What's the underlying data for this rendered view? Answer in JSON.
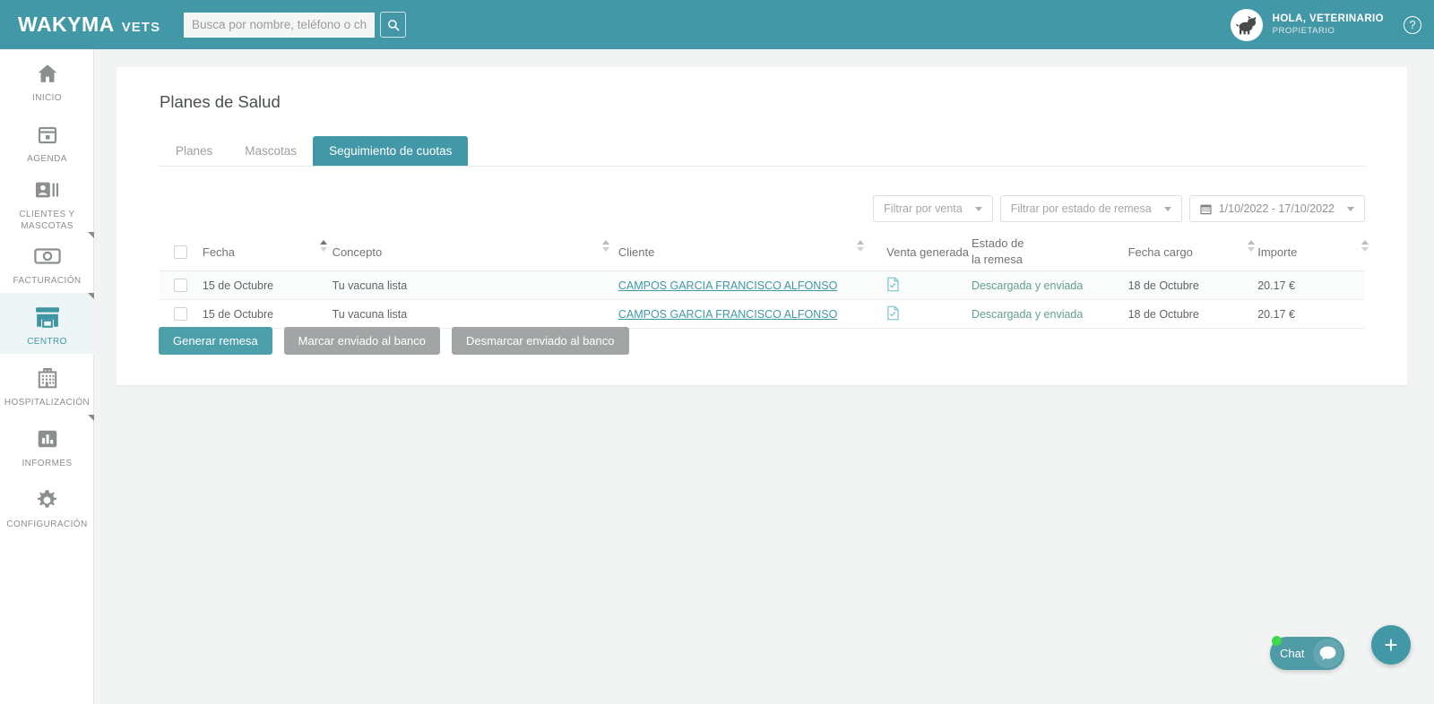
{
  "brand": {
    "main": "WAKYMA",
    "sub": "VETS"
  },
  "search": {
    "placeholder": "Busca por nombre, teléfono o chip",
    "value": "",
    "icon": "search-icon"
  },
  "user": {
    "greeting": "HOLA, VETERINARIO",
    "role": "PROPIETARIO",
    "help": "?"
  },
  "colors": {
    "brand_teal": "#4398a7",
    "active_nav_bg": "#eef5f6",
    "page_bg": "#f2f4f4",
    "status_green": "#62a08a",
    "secondary_btn": "#a2a5a6",
    "chat_green_dot": "#3ddb4a"
  },
  "sidebar": {
    "items": [
      {
        "label": "INICIO",
        "icon": "home-icon",
        "active": false
      },
      {
        "label": "AGENDA",
        "icon": "calendar-icon",
        "active": false
      },
      {
        "label": "CLIENTES Y MASCOTAS",
        "icon": "contacts-icon",
        "active": false
      },
      {
        "label": "FACTURACIÓN",
        "icon": "banknote-icon",
        "active": false
      },
      {
        "label": "CENTRO",
        "icon": "store-icon",
        "active": true
      },
      {
        "label": "HOSPITALIZACIÓN",
        "icon": "hospital-icon",
        "active": false
      },
      {
        "label": "INFORMES",
        "icon": "bar-chart-icon",
        "active": false
      },
      {
        "label": "CONFIGURACIÓN",
        "icon": "gear-icon",
        "active": false
      }
    ]
  },
  "main": {
    "title": "Planes de Salud",
    "tabs": [
      {
        "label": "Planes",
        "active": false
      },
      {
        "label": "Mascotas",
        "active": false
      },
      {
        "label": "Seguimiento de cuotas",
        "active": true
      }
    ],
    "filters": [
      {
        "label": "Filtrar por venta",
        "type": "dropdown"
      },
      {
        "label": "Filtrar por estado de remesa",
        "type": "dropdown"
      }
    ],
    "date_range": {
      "label": "1/10/2022 - 17/10/2022",
      "icon": "calendar-icon"
    },
    "table": {
      "columns": [
        {
          "key": "select",
          "label": ""
        },
        {
          "key": "fecha",
          "label": "Fecha",
          "sortable": true,
          "sorted": "asc"
        },
        {
          "key": "concepto",
          "label": "Concepto",
          "sortable": true
        },
        {
          "key": "cliente",
          "label": "Cliente",
          "sortable": true
        },
        {
          "key": "venta",
          "label": "Venta generada",
          "sortable": true
        },
        {
          "key": "estado",
          "label": "Estado de la remesa",
          "label_line1": "Estado de",
          "label_line2": "la remesa"
        },
        {
          "key": "fecha_cargo",
          "label": "Fecha cargo",
          "sortable": true
        },
        {
          "key": "importe",
          "label": "Importe",
          "sortable": true
        }
      ],
      "rows": [
        {
          "fecha": "15 de Octubre",
          "concepto": "Tu vacuna lista",
          "cliente": "CAMPOS GARCIA FRANCISCO ALFONSO",
          "venta_icon": "document-check-icon",
          "estado": "Descargada y enviada",
          "fecha_cargo": "18 de Octubre",
          "importe": "20.17 €",
          "checked": false
        },
        {
          "fecha": "15 de Octubre",
          "concepto": "Tu vacuna lista",
          "cliente": "CAMPOS GARCIA FRANCISCO ALFONSO",
          "venta_icon": "document-check-icon",
          "estado": "Descargada y enviada",
          "fecha_cargo": "18 de Octubre",
          "importe": "20.17 €",
          "checked": false
        }
      ]
    },
    "actions": [
      {
        "label": "Generar remesa",
        "style": "primary"
      },
      {
        "label": "Marcar enviado al banco",
        "style": "secondary"
      },
      {
        "label": "Desmarcar enviado al banco",
        "style": "secondary"
      }
    ]
  },
  "chat": {
    "label": "Chat",
    "icon": "chat-bubble-icon",
    "online": true
  },
  "fab": {
    "label": "+",
    "icon": "plus-icon"
  }
}
